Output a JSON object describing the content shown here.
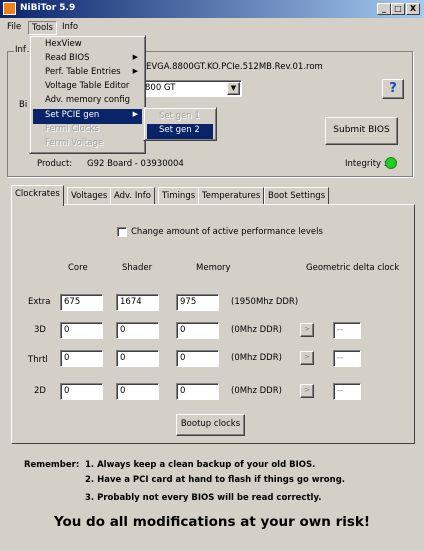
{
  "window": {
    "title": "NiBiTor 5.9",
    "min": "_",
    "max": "□",
    "close": "X"
  },
  "menubar": [
    "File",
    "Tools",
    "Info"
  ],
  "tools_menu": [
    {
      "label": "HexView",
      "arrow": false,
      "disabled": false
    },
    {
      "label": "Read BIOS",
      "arrow": true,
      "disabled": false
    },
    {
      "label": "Perf. Table Entries",
      "arrow": true,
      "disabled": false
    },
    {
      "label": "Voltage Table Editor",
      "arrow": false,
      "disabled": false
    },
    {
      "label": "Adv. memory config",
      "arrow": false,
      "disabled": false
    },
    {
      "label": "Set PCIE gen",
      "arrow": true,
      "disabled": false,
      "selected": true
    },
    {
      "label": "Fermi Clocks",
      "arrow": false,
      "disabled": true
    },
    {
      "label": "Fermi Voltage",
      "arrow": false,
      "disabled": true
    }
  ],
  "pcie_submenu": [
    {
      "label": "Set gen 1",
      "disabled": true
    },
    {
      "label": "Set gen 2",
      "disabled": false,
      "selected": true
    }
  ],
  "info": {
    "group_label": "Inf",
    "bios_file": "EVGA.8800GT.KO.PCIe.512MB.Rev.01.rom",
    "card_label": "Bi",
    "card_value": "800 GT",
    "help": "?",
    "submit": "Submit BIOS",
    "product_label": "Product:",
    "product_value": "G92 Board - 03930004",
    "integrity_label": "Integrity :",
    "integrity_color": "#20d020"
  },
  "tabs": [
    "Clockrates",
    "Voltages",
    "Adv. Info",
    "Timings",
    "Temperatures",
    "Boot Settings"
  ],
  "clockrates": {
    "checkbox_label": "Change amount of active performance levels",
    "headers": {
      "core": "Core",
      "shader": "Shader",
      "memory": "Memory",
      "delta": "Geometric delta clock"
    },
    "rows": [
      {
        "label": "Extra",
        "core": "675",
        "shader": "1674",
        "memory": "975",
        "note": "(1950Mhz DDR)",
        "delta": false
      },
      {
        "label": "3D",
        "core": "0",
        "shader": "0",
        "memory": "0",
        "note": "(0Mhz DDR)",
        "delta": true,
        "delta_value": "--"
      },
      {
        "label": "Thrtl",
        "core": "0",
        "shader": "0",
        "memory": "0",
        "note": "(0Mhz DDR)",
        "delta": true,
        "delta_value": "--"
      },
      {
        "label": "2D",
        "core": "0",
        "shader": "0",
        "memory": "0",
        "note": "(0Mhz DDR)",
        "delta": true,
        "delta_value": "--"
      }
    ],
    "delta_btn": ">",
    "bootup_button": "Bootup clocks"
  },
  "remember": {
    "prefix": "Remember:",
    "lines": [
      "1. Always keep a clean backup of your old BIOS.",
      "2. Have a PCI card at hand to flash if things go wrong.",
      "3. Probably not every BIOS will be read correctly."
    ],
    "risk": "You do all modifications at your own risk!"
  }
}
